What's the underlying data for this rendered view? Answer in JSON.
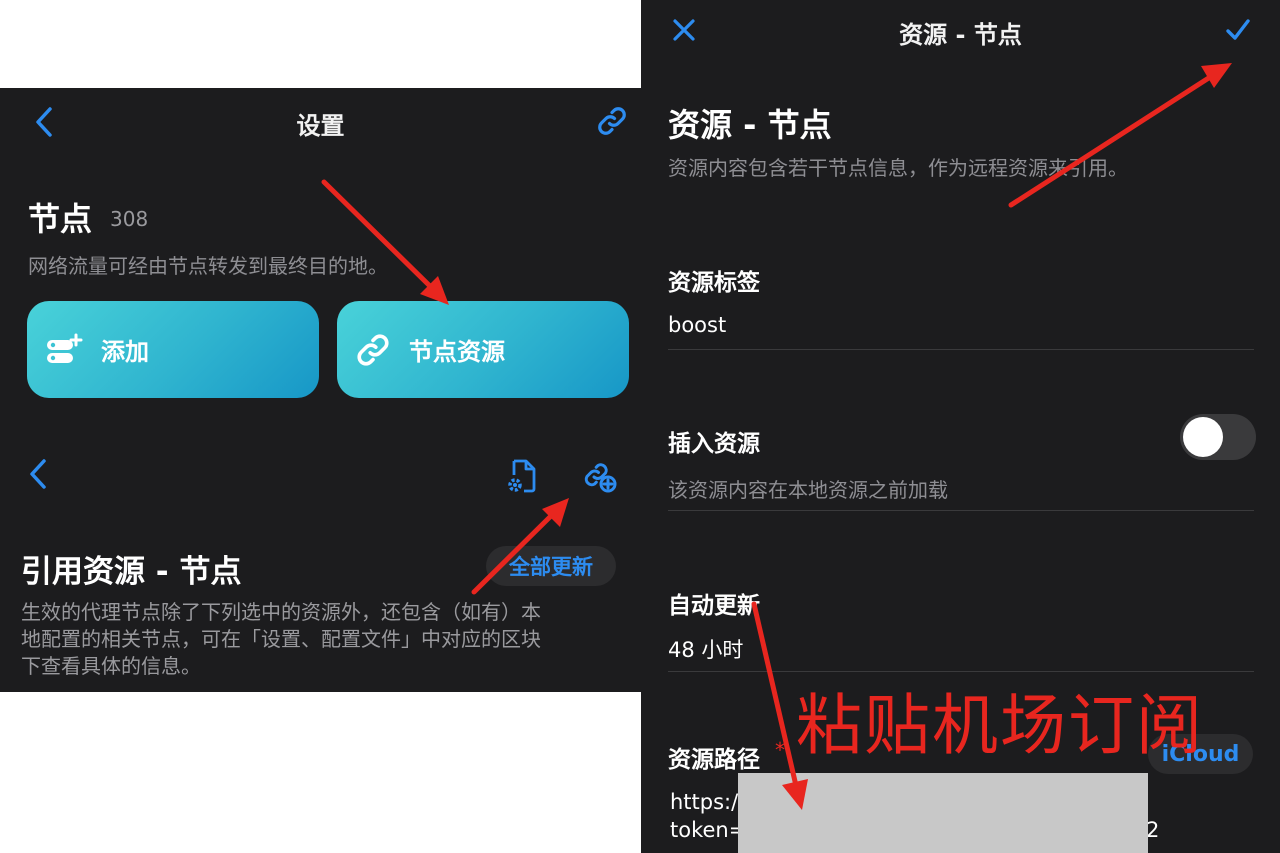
{
  "left": {
    "nav": {
      "title": "设置"
    },
    "nodes": {
      "title": "节点",
      "count": "308",
      "description": "网络流量可经由节点转发到最终目的地。",
      "add_label": "添加",
      "resource_label": "节点资源"
    },
    "refs": {
      "title": "引用资源 - 节点",
      "update_all": "全部更新",
      "description_line1": "生效的代理节点除了下列选中的资源外，还包含（如有）本",
      "description_line2": "地配置的相关节点，可在「设置、配置文件」中对应的区块",
      "description_line3": "下查看具体的信息。"
    }
  },
  "right": {
    "nav": {
      "title": "资源 - 节点"
    },
    "header": {
      "title": "资源 - 节点",
      "description": "资源内容包含若干节点信息，作为远程资源来引用。"
    },
    "tag": {
      "label": "资源标签",
      "value": "boost"
    },
    "insert": {
      "label": "插入资源",
      "description": "该资源内容在本地资源之前加载",
      "enabled": false
    },
    "auto_update": {
      "label": "自动更新",
      "value": "48 小时"
    },
    "path": {
      "label": "资源路径",
      "required_mark": "*",
      "icloud": "iCloud",
      "line1": "https://",
      "line2": "token=",
      "line2_tail": "2"
    },
    "annotation": "粘贴机场订阅"
  },
  "colors": {
    "background": "#1c1c1e",
    "accent": "#2d8cf0",
    "tile_gradient_start": "#49d2d9",
    "tile_gradient_end": "#1797c7",
    "annotation_red": "#e8261f",
    "redaction": "#c8c8c8"
  }
}
